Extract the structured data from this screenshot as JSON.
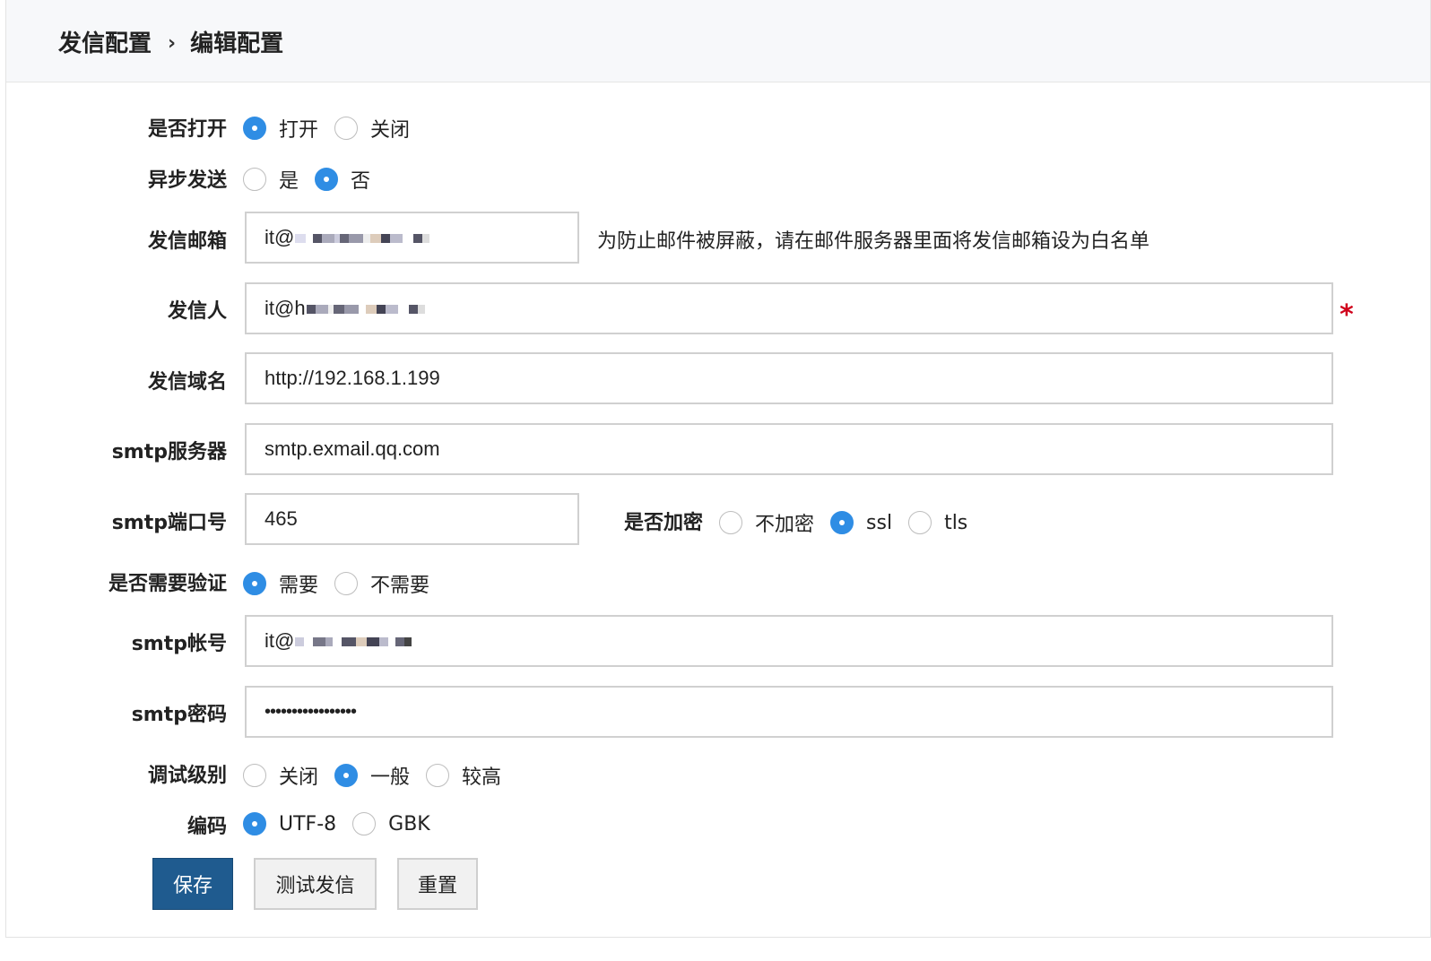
{
  "breadcrumb": {
    "parent": "发信配置",
    "separator": "›",
    "current": "编辑配置"
  },
  "fields": {
    "enabled": {
      "label": "是否打开",
      "options": [
        "打开",
        "关闭"
      ],
      "selected": 0
    },
    "async_send": {
      "label": "异步发送",
      "options": [
        "是",
        "否"
      ],
      "selected": 1
    },
    "sender_email": {
      "label": "发信邮箱",
      "value": "it@",
      "hint": "为防止邮件被屏蔽，请在邮件服务器里面将发信邮箱设为白名单"
    },
    "sender_name": {
      "label": "发信人",
      "value": "it@h",
      "required_mark": "*"
    },
    "domain": {
      "label": "发信域名",
      "value": "http://192.168.1.199"
    },
    "smtp_server": {
      "label": "smtp服务器",
      "value": "smtp.exmail.qq.com"
    },
    "smtp_port": {
      "label": "smtp端口号",
      "value": "465"
    },
    "encryption": {
      "label": "是否加密",
      "options": [
        "不加密",
        "ssl",
        "tls"
      ],
      "selected": 1
    },
    "auth_required": {
      "label": "是否需要验证",
      "options": [
        "需要",
        "不需要"
      ],
      "selected": 0
    },
    "smtp_account": {
      "label": "smtp帐号",
      "value": "it@"
    },
    "smtp_password": {
      "label": "smtp密码",
      "value": "•••••••••••••••••"
    },
    "debug_level": {
      "label": "调试级别",
      "options": [
        "关闭",
        "一般",
        "较高"
      ],
      "selected": 1
    },
    "encoding": {
      "label": "编码",
      "options": [
        "UTF-8",
        "GBK"
      ],
      "selected": 0
    }
  },
  "buttons": {
    "save": "保存",
    "test": "测试发信",
    "reset": "重置"
  },
  "colors": {
    "primary_button": "#1f5b8f",
    "radio_selected": "#2f8de4",
    "required": "#d0021b"
  }
}
